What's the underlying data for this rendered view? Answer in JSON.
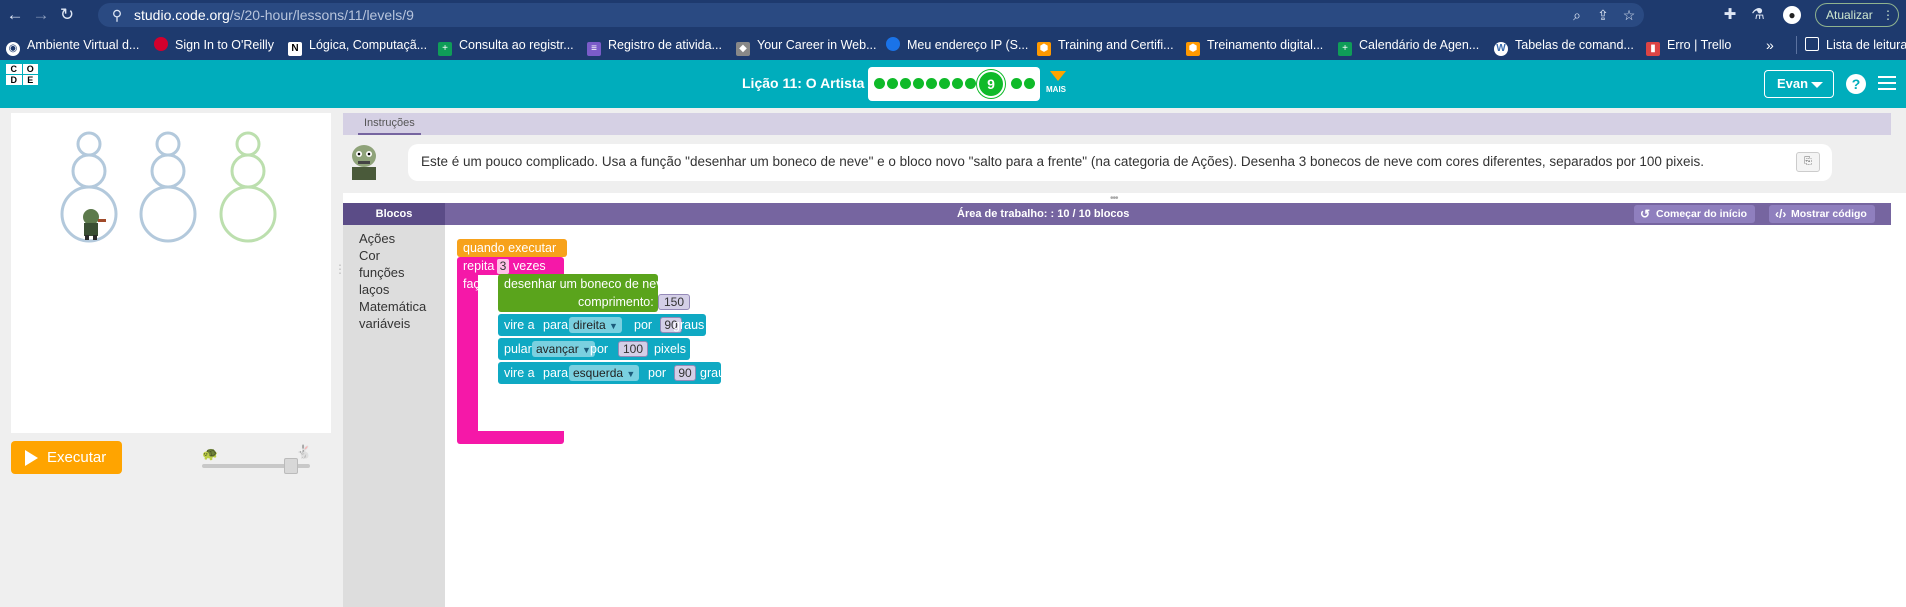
{
  "browser": {
    "url_host": "studio.code.org",
    "url_path": "/s/20-hour/lessons/11/levels/9",
    "update_label": "Atualizar"
  },
  "bookmarks": [
    {
      "label": "Ambiente Virtual d...",
      "color": "#ffffff"
    },
    {
      "label": "Sign In to O'Reilly",
      "color": "#d3002d"
    },
    {
      "label": "Lógica, Computaçã...",
      "color": "#000000"
    },
    {
      "label": "Consulta ao registr...",
      "color": "#0f9d58"
    },
    {
      "label": "Registro de ativida...",
      "color": "#7b5cc9"
    },
    {
      "label": "Your Career in Web...",
      "color": "#888888"
    },
    {
      "label": "Meu endereço IP (S...",
      "color": "#1a73e8"
    },
    {
      "label": "Training and Certifi...",
      "color": "#ff9900"
    },
    {
      "label": "Treinamento digital...",
      "color": "#ff9900"
    },
    {
      "label": "Calendário de Agen...",
      "color": "#0f9d58"
    },
    {
      "label": "Tabelas de comand...",
      "color": "#3b6db0"
    },
    {
      "label": "Erro | Trello",
      "color": "#d44"
    }
  ],
  "bookmarks_more": "»",
  "reading_list": "Lista de leitura",
  "header": {
    "lesson_title": "Lição 11: O Artista 3",
    "current_level": "9",
    "more_label": "MAIS",
    "user_name": "Evan",
    "logo_letters": [
      "C",
      "O",
      "D",
      "E",
      "",
      ""
    ]
  },
  "instructions": {
    "tab_label": "Instruções",
    "text": "Este é um pouco complicado. Usa a função \"desenhar um boneco de neve\" e o bloco novo \"salto para a frente\" (na categoria de Ações). Desenha 3 bonecos de neve com cores diferentes, separados por 100 pixeis."
  },
  "run_button": "Executar",
  "workspace": {
    "blocks_label": "Blocos",
    "title": "Área de trabalho: : 10 / 10 blocos",
    "start_over": "Começar do início",
    "show_code": "Mostrar código"
  },
  "toolbox": [
    "Ações",
    "Cor",
    "funções",
    "laços",
    "Matemática",
    "variáveis"
  ],
  "code_blocks": {
    "when_run": "quando executar",
    "repeat": "repita",
    "repeat_count": "3",
    "times": "vezes",
    "do": "faça",
    "draw_snowman": "desenhar um boneco de neve",
    "length": "comprimento:",
    "length_value": "150",
    "turn": "vire a",
    "para": "para",
    "right": "direita",
    "by": "por",
    "angle1": "90",
    "degrees": "graus",
    "jump": "pular",
    "forward": "avançar",
    "jump_value": "100",
    "pixels": "pixels",
    "left": "esquerda",
    "angle2": "90"
  },
  "snowmen_colors": [
    "#b3c9dc",
    "#b3c9dc",
    "#bcdfae"
  ]
}
